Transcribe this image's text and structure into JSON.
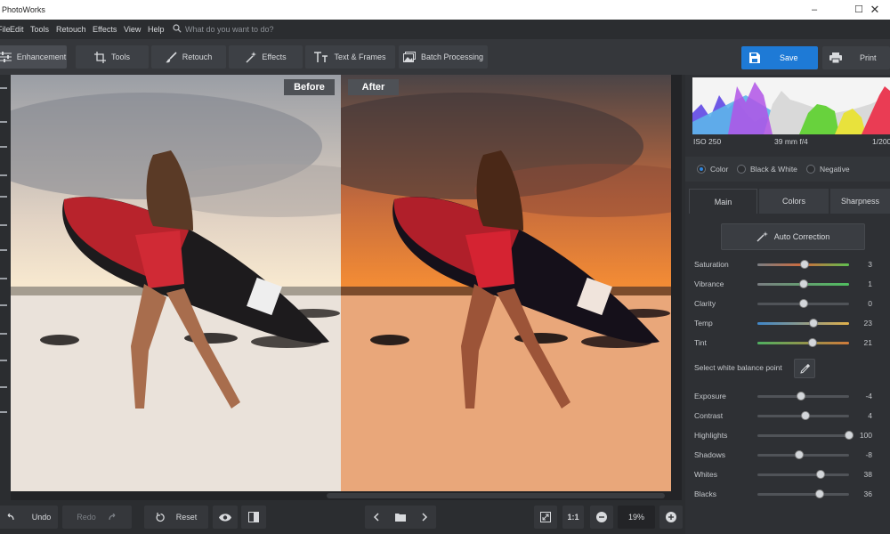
{
  "app": {
    "title": "PhotoWorks"
  },
  "menu": {
    "items": [
      "File",
      "Edit",
      "Tools",
      "Retouch",
      "Effects",
      "View",
      "Help"
    ],
    "search_placeholder": "What do you want to do?"
  },
  "toolbar": {
    "tabs": [
      "Enhancement",
      "Tools",
      "Retouch",
      "Effects",
      "Text & Frames",
      "Batch Processing"
    ],
    "active_tab": "Enhancement",
    "save_label": "Save",
    "print_label": "Print"
  },
  "canvas": {
    "before_label": "Before",
    "after_label": "After"
  },
  "bottom": {
    "undo": "Undo",
    "redo": "Redo",
    "reset": "Reset",
    "ratio": "1:1",
    "zoom": "19%"
  },
  "histogram": {
    "iso": "ISO 250",
    "lens": "39 mm f/4",
    "shutter": "1/200"
  },
  "modes": {
    "color": "Color",
    "bw": "Black & White",
    "negative": "Negative",
    "selected": "Color"
  },
  "subtabs": {
    "main": "Main",
    "colors": "Colors",
    "sharpness": "Sharpness",
    "active": "Main"
  },
  "auto_correction": "Auto Correction",
  "white_balance_label": "Select white balance point",
  "sliders": [
    {
      "label": "Saturation",
      "value": "3",
      "min": -100,
      "max": 100,
      "fill": "saturation"
    },
    {
      "label": "Vibrance",
      "value": "1",
      "min": -100,
      "max": 100,
      "fill": "vibrance"
    },
    {
      "label": "Clarity",
      "value": "0",
      "min": -100,
      "max": 100,
      "fill": "none"
    },
    {
      "label": "Temp",
      "value": "23",
      "min": -100,
      "max": 100,
      "fill": "temp"
    },
    {
      "label": "Tint",
      "value": "21",
      "min": -100,
      "max": 100,
      "fill": "tint"
    },
    {
      "label": "Exposure",
      "value": "-4",
      "min": -100,
      "max": 100,
      "fill": "none"
    },
    {
      "label": "Contrast",
      "value": "4",
      "min": -100,
      "max": 100,
      "fill": "none"
    },
    {
      "label": "Highlights",
      "value": "100",
      "min": -100,
      "max": 100,
      "fill": "none"
    },
    {
      "label": "Shadows",
      "value": "-8",
      "min": -100,
      "max": 100,
      "fill": "none"
    },
    {
      "label": "Whites",
      "value": "38",
      "min": -100,
      "max": 100,
      "fill": "none"
    },
    {
      "label": "Blacks",
      "value": "36",
      "min": -100,
      "max": 100,
      "fill": "none"
    }
  ],
  "colors": {
    "accent": "#1e7ad6",
    "panel": "#2e3034",
    "toolbar": "#35373b"
  }
}
